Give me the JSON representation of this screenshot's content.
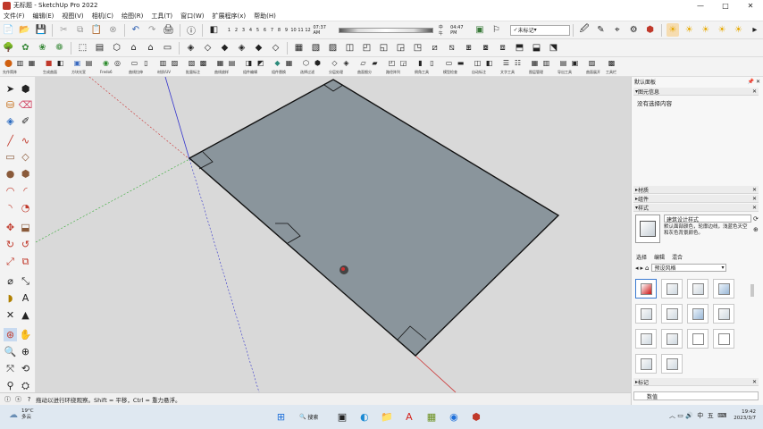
{
  "window": {
    "title": "无标题 - SketchUp Pro 2022",
    "controls": [
      "—",
      "□",
      "✕"
    ]
  },
  "menu": [
    "文件(F)",
    "编辑(E)",
    "视图(V)",
    "相机(C)",
    "绘图(R)",
    "工具(T)",
    "窗口(W)",
    "扩展程序(x)",
    "帮助(H)"
  ],
  "shadow": {
    "months": [
      "1",
      "2",
      "3",
      "4",
      "5",
      "6",
      "7",
      "8",
      "9",
      "10",
      "11",
      "12"
    ],
    "time_start": "07:37 AM",
    "noon": "中午",
    "time_end": "04:47 PM"
  },
  "scene_select": "未标记",
  "plugin_labels": [
    "先作筒阵",
    "生成曲面",
    "方块光宣",
    "Fredo6",
    "曲线拉伸",
    "材质/UV",
    "批量标注",
    "曲线放样",
    "组件编辑",
    "组件替换",
    "选择过滤",
    "分层处理",
    "曲面细分",
    "路径阵列",
    "倒角工具",
    "模型检查",
    "自动标注",
    "文字工具",
    "图层管理",
    "导出工具",
    "曲面展开",
    "工具栏"
  ],
  "tray": {
    "panel_title": "默认面板",
    "entity_info_title": "图元信息",
    "entity_info_text": "没有选择内容",
    "materials_title": "材质",
    "components_title": "组件",
    "styles_title": "样式",
    "style_name": "建筑设计样式",
    "style_desc": "默认面部颜色，轮廓边线，浅蓝色天空和灰色背景颜色。",
    "tabs": [
      "选择",
      "编辑",
      "混合"
    ],
    "style_filter": "预设风格",
    "tags_title": "标记",
    "value_label": "数值"
  },
  "status": {
    "hint": "拖动以进行环绕观察。Shift = 平移，Ctrl = 重力悬浮。"
  },
  "taskbar": {
    "weather_temp": "19°C",
    "weather_desc": "多云",
    "search_label": "搜索",
    "ime": "中",
    "ime2": "五",
    "time": "19:42",
    "date": "2023/3/7"
  },
  "colors": {
    "face": "#8a959c",
    "edge": "#111111",
    "axis_red": "#cc3333",
    "axis_green": "#33aa33",
    "axis_blue": "#3333cc",
    "sky": "#d9d9d9"
  }
}
